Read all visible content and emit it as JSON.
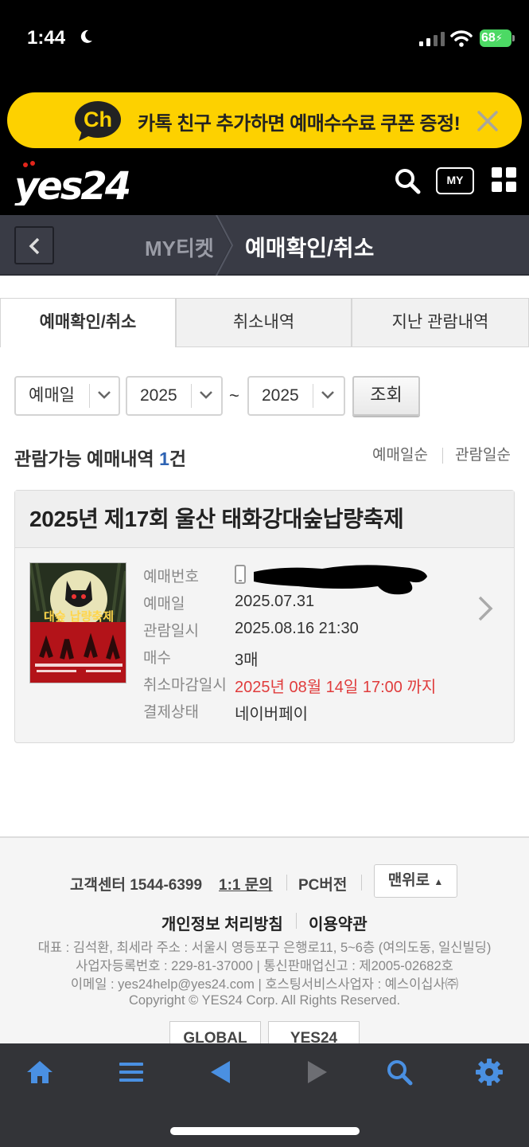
{
  "status_bar": {
    "time": "1:44",
    "battery": "68"
  },
  "banner": {
    "logo_text": "Ch",
    "text": "카톡 친구 추가하면 예매수수료 쿠폰 증정!"
  },
  "header": {
    "logo": "yes24",
    "my_label": "MY"
  },
  "breadcrumb": {
    "parent": "MY티켓",
    "current": "예매확인/취소"
  },
  "tabs": [
    {
      "label": "예매확인/취소",
      "active": true
    },
    {
      "label": "취소내역",
      "active": false
    },
    {
      "label": "지난 관람내역",
      "active": false
    }
  ],
  "filter": {
    "type": "예매일",
    "year_from": "2025",
    "tilde": "~",
    "year_to": "2025",
    "search_label": "조회"
  },
  "summary": {
    "prefix": "관람가능 예매내역 ",
    "count": "1",
    "suffix": "건"
  },
  "sort": {
    "by_booking": "예매일순",
    "by_show": "관람일순"
  },
  "booking": {
    "title": "2025년 제17회 울산 태화강대숲납량축제",
    "rows": [
      {
        "label": "예매번호",
        "value": ""
      },
      {
        "label": "예매일",
        "value": "2025.07.31"
      },
      {
        "label": "관람일시",
        "value": "2025.08.16 21:30"
      },
      {
        "label": "매수",
        "value": "3매"
      },
      {
        "label": "취소마감일시",
        "value": "2025년 08월 14일 17:00 까지"
      },
      {
        "label": "결제상태",
        "value": "네이버페이"
      }
    ],
    "poster_text": "대숲 납량축제"
  },
  "footer": {
    "cs": "고객센터 1544-6399",
    "inquiry": "1:1 문의",
    "pc": "PC버전",
    "top": "맨위로",
    "privacy": "개인정보 처리방침",
    "terms": "이용약관",
    "line1": "대표 : 김석환, 최세라    주소 : 서울시 영등포구 은행로11, 5~6층 (여의도동, 일신빌딩)",
    "line2": "사업자등록번호 : 229-81-37000  |  통신판매업신고 : 제2005-02682호",
    "line3": "이메일 : yes24help@yes24.com  |  호스팅서비스사업자 : 예스이십사㈜",
    "copyright": "Copyright © YES24 Corp. All Rights Reserved.",
    "global": "GLOBAL",
    "yes24": "YES24"
  },
  "colors": {
    "accent_blue": "#2e63b3",
    "deadline_red": "#e03c3c",
    "kakao_yellow": "#fdd100",
    "toolbar_icon": "#4a90e2"
  }
}
